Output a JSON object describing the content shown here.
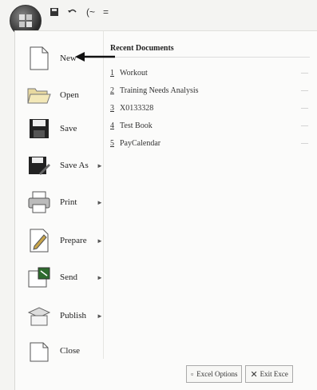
{
  "qat": {
    "redo_label": "(~",
    "more_label": "="
  },
  "menu_items": [
    {
      "label": "New",
      "arrow": ""
    },
    {
      "label": "Open",
      "arrow": ""
    },
    {
      "label": "Save",
      "arrow": ""
    },
    {
      "label": "Save As",
      "arrow": "►"
    },
    {
      "label": "Print",
      "arrow": "►"
    },
    {
      "label": "Prepare",
      "arrow": "►"
    },
    {
      "label": "Send",
      "arrow": "►"
    },
    {
      "label": "Publish",
      "arrow": "►"
    },
    {
      "label": "Close",
      "arrow": ""
    }
  ],
  "recent": {
    "title": "Recent Documents",
    "docs": [
      {
        "num": "1",
        "name": "Workout"
      },
      {
        "num": "2",
        "name": "Training Needs Analysis"
      },
      {
        "num": "3",
        "name": "X0133328"
      },
      {
        "num": "4",
        "name": "Test Book"
      },
      {
        "num": "5",
        "name": "PayCalendar"
      }
    ]
  },
  "footer": {
    "options_label": "Excel Options",
    "exit_label": "Exit Exce"
  }
}
